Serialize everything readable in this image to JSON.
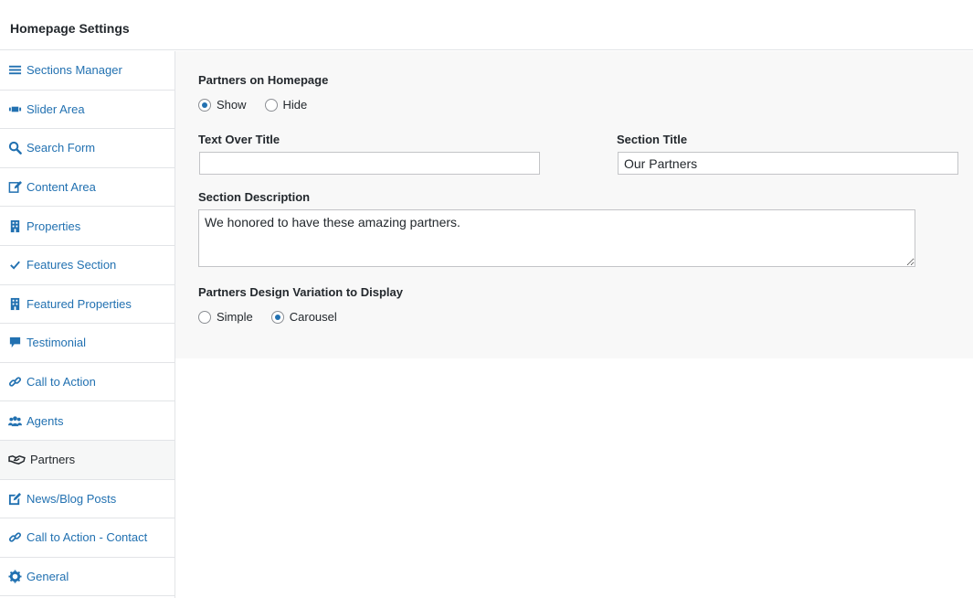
{
  "header": {
    "title": "Homepage Settings"
  },
  "sidebar": {
    "items": [
      {
        "label": "Sections Manager",
        "icon": "menu-icon"
      },
      {
        "label": "Slider Area",
        "icon": "slides-icon"
      },
      {
        "label": "Search Form",
        "icon": "search-icon"
      },
      {
        "label": "Content Area",
        "icon": "edit-icon"
      },
      {
        "label": "Properties",
        "icon": "building-icon"
      },
      {
        "label": "Features Section",
        "icon": "checkmark-icon"
      },
      {
        "label": "Featured Properties",
        "icon": "building-icon"
      },
      {
        "label": "Testimonial",
        "icon": "speech-bubble-icon"
      },
      {
        "label": "Call to Action",
        "icon": "link-icon"
      },
      {
        "label": "Agents",
        "icon": "users-icon"
      },
      {
        "label": "Partners",
        "icon": "handshake-icon"
      },
      {
        "label": "News/Blog Posts",
        "icon": "post-edit-icon"
      },
      {
        "label": "Call to Action - Contact",
        "icon": "link-icon"
      },
      {
        "label": "General",
        "icon": "gear-icon"
      }
    ],
    "active": "Partners"
  },
  "form": {
    "partners_label": "Partners on Homepage",
    "partners_options": {
      "show": "Show",
      "hide": "Hide"
    },
    "partners_selected": "Show",
    "text_over_title_label": "Text Over Title",
    "text_over_title_value": "",
    "section_title_label": "Section Title",
    "section_title_value": "Our Partners",
    "section_description_label": "Section Description",
    "section_description_value": "We honored to have these amazing partners.",
    "design_label": "Partners Design Variation to Display",
    "design_options": {
      "simple": "Simple",
      "carousel": "Carousel"
    },
    "design_selected": "Carousel"
  },
  "colors": {
    "link": "#2271b1",
    "text": "#23282d",
    "border": "#e2e4e7",
    "panel_bg": "#f8f8f8"
  }
}
